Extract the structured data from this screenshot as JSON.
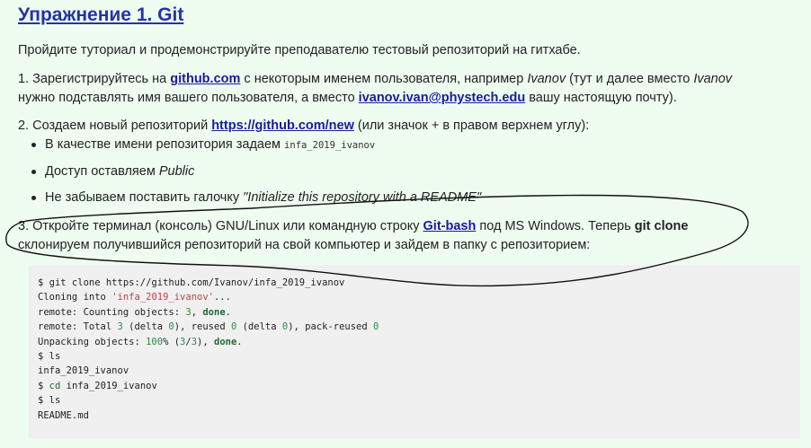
{
  "title": "Упражнение 1. Git",
  "intro": "Пройдите туториал и продемонстрируйте преподавателю тестовый репозиторий на гитхабе.",
  "step1": {
    "prefix": "1. Зарегистрируйтесь на ",
    "link": "github.com",
    "mid1": " с некоторым именем пользователя, например ",
    "example_user": "Ivanov",
    "mid2": " (тут и далее вместо ",
    "example_user2": "Ivanov",
    "line2_a": "нужно подставлять имя вашего пользователя, а вместо ",
    "email": "ivanov.ivan@phystech.edu",
    "line2_b": " вашу настоящую почту)."
  },
  "step2": {
    "prefix": "2. Создаем новый репозиторий ",
    "link": "https://github.com/new",
    "suffix": " (или значок + в правом верхнем углу):",
    "bullets": [
      {
        "text": "В качестве имени репозитория задаем ",
        "code": "infa_2019_ivanov"
      },
      {
        "text": "Доступ оставляем ",
        "em": "Public"
      },
      {
        "text": "Не забываем поставить галочку ",
        "em": "\"Initialize this repository with a README\""
      }
    ]
  },
  "step3": {
    "prefix": "3. Откройте терминал (консоль) GNU/Linux или командную строку ",
    "link": "Git-bash",
    "mid": " под MS Windows. Теперь ",
    "bold": "git clone",
    "line2": "склонируем получившийся репозиторий на свой компьютер и зайдем в папку с репозиторием:"
  },
  "code": {
    "l1": "$ git clone https://github.com/Ivanov/infa_2019_ivanov",
    "l2_a": "Cloning into ",
    "l2_str": "'infa_2019_ivanov'",
    "l2_b": "...",
    "l3_a": "remote: Counting objects: ",
    "l3_n": "3",
    "l3_b": ", ",
    "l3_kw": "done",
    "l3_c": ".",
    "l4_a": "remote: Total ",
    "l4_n1": "3",
    "l4_b": " (delta ",
    "l4_n2": "0",
    "l4_c": "), reused ",
    "l4_n3": "0",
    "l4_d": " (delta ",
    "l4_n4": "0",
    "l4_e": "), pack-reused ",
    "l4_n5": "0",
    "l5_a": "Unpacking objects: ",
    "l5_n1": "100",
    "l5_b": "% (",
    "l5_n2": "3",
    "l5_c": "/",
    "l5_n3": "3",
    "l5_d": "), ",
    "l5_kw": "done",
    "l5_e": ".",
    "l6": "$ ls",
    "l7": "infa_2019_ivanov",
    "l8_a": "$ ",
    "l8_kw": "cd",
    "l8_b": " infa_2019_ivanov",
    "l9": "$ ls",
    "l10": "README.md"
  },
  "annotation_color": "#111111"
}
